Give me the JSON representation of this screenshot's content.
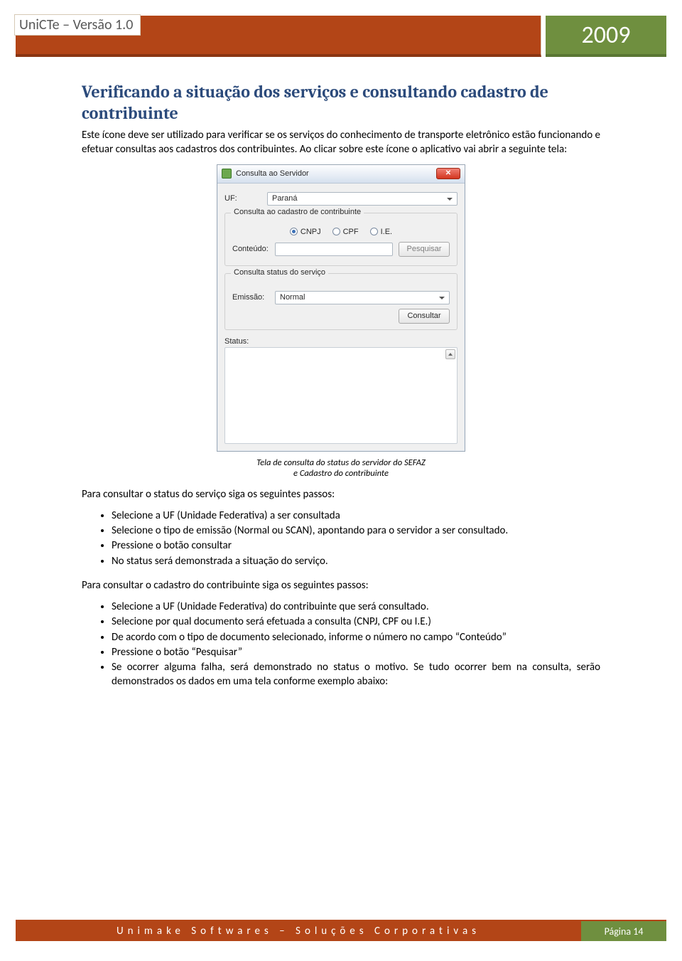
{
  "header": {
    "title": "UniCTe – Versão 1.0",
    "year": "2009"
  },
  "section": {
    "heading": "Verificando a situação dos serviços e consultando cadastro de contribuinte",
    "intro": "Este ícone deve ser utilizado para verificar se os serviços do conhecimento de transporte eletrônico estão funcionando e efetuar consultas aos cadastros dos contribuintes. Ao clicar sobre este ícone o aplicativo vai abrir a seguinte tela:"
  },
  "dialog": {
    "title": "Consulta ao Servidor",
    "uf_label": "UF:",
    "uf_value": "Paraná",
    "group_cadastro": {
      "legend": "Consulta ao cadastro de contribuinte",
      "radios": {
        "cnpj": "CNPJ",
        "cpf": "CPF",
        "ie": "I.E."
      },
      "selected": "cnpj",
      "conteudo_label": "Conteúdo:",
      "btn_pesquisar": "Pesquisar"
    },
    "group_status": {
      "legend": "Consulta status do serviço",
      "emissao_label": "Emissão:",
      "emissao_value": "Normal",
      "btn_consultar": "Consultar"
    },
    "status_label": "Status:"
  },
  "caption": {
    "line1": "Tela de consulta do status do servidor do SEFAZ",
    "line2": "e Cadastro do contribuinte"
  },
  "body": {
    "p1": "Para consultar o status do serviço siga os seguintes passos:",
    "list1": {
      "i0": "Selecione a UF (Unidade Federativa) a ser consultada",
      "i1": "Selecione o tipo de emissão (Normal ou SCAN), apontando para o servidor a ser consultado.",
      "i2": "Pressione o botão consultar",
      "i3": "No status será demonstrada a situação do serviço."
    },
    "p2": "Para consultar o cadastro do contribuinte siga os seguintes passos:",
    "list2": {
      "i0": "Selecione a UF (Unidade Federativa) do contribuinte que será consultado.",
      "i1": "Selecione por qual documento será efetuada a consulta (CNPJ, CPF ou I.E.)",
      "i2": "De acordo com o tipo de documento selecionado, informe o número no campo “Conteúdo”",
      "i3": "Pressione o botão “Pesquisar”",
      "i4": "Se ocorrer alguma falha, será demonstrado no status o motivo. Se tudo ocorrer bem na consulta, serão demonstrados os dados em uma tela conforme exemplo abaixo:"
    }
  },
  "footer": {
    "left": "Unimake Softwares – Soluções Corporativas",
    "right": "Página 14"
  }
}
